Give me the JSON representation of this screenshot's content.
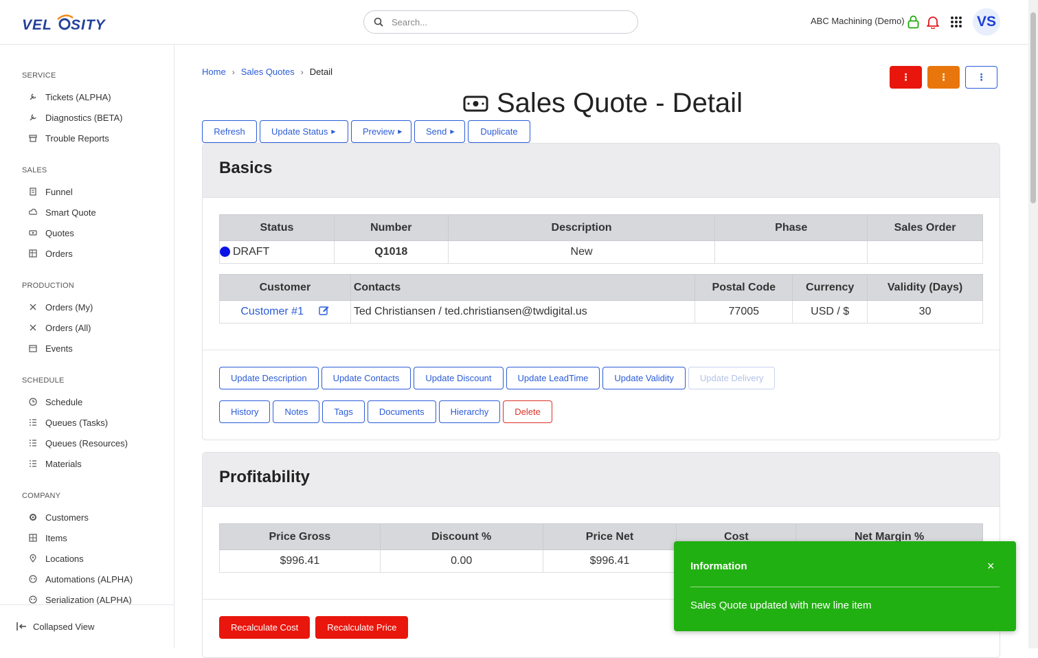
{
  "header": {
    "search_placeholder": "Search...",
    "company": "ABC Machining (Demo)",
    "avatar": "VS"
  },
  "sidebar": {
    "sections": [
      {
        "title": "SERVICE",
        "items": [
          "Tickets (ALPHA)",
          "Diagnostics (BETA)",
          "Trouble Reports"
        ]
      },
      {
        "title": "SALES",
        "items": [
          "Funnel",
          "Smart Quote",
          "Quotes",
          "Orders"
        ]
      },
      {
        "title": "PRODUCTION",
        "items": [
          "Orders (My)",
          "Orders (All)",
          "Events"
        ]
      },
      {
        "title": "SCHEDULE",
        "items": [
          "Schedule",
          "Queues (Tasks)",
          "Queues (Resources)",
          "Materials"
        ]
      },
      {
        "title": "COMPANY",
        "items": [
          "Customers",
          "Items",
          "Locations",
          "Automations (ALPHA)",
          "Serialization (ALPHA)"
        ]
      }
    ],
    "collapsed_label": "Collapsed View"
  },
  "breadcrumb": {
    "home": "Home",
    "section": "Sales Quotes",
    "current": "Detail"
  },
  "action_buttons": {
    "more": "⋮"
  },
  "page_title": "Sales Quote - Detail",
  "toolbar": {
    "refresh": "Refresh",
    "update_status": "Update Status",
    "preview": "Preview",
    "send": "Send",
    "duplicate": "Duplicate"
  },
  "basics": {
    "title": "Basics",
    "table1": {
      "headers": [
        "Status",
        "Number",
        "Description",
        "Phase",
        "Sales Order"
      ],
      "status": "DRAFT",
      "number": "Q1018",
      "description": "New",
      "phase": "",
      "sales_order": ""
    },
    "table2": {
      "headers": [
        "Customer",
        "Contacts",
        "Postal Code",
        "Currency",
        "Validity (Days)"
      ],
      "customer": "Customer #1",
      "contacts": "Ted Christiansen / ted.christiansen@twdigital.us",
      "postal_code": "77005",
      "currency": "USD / $",
      "validity": "30"
    },
    "buttons_row1": [
      "Update Description",
      "Update Contacts",
      "Update Discount",
      "Update LeadTime",
      "Update Validity",
      "Update Delivery"
    ],
    "buttons_row2": [
      "History",
      "Notes",
      "Tags",
      "Documents",
      "Hierarchy",
      "Delete"
    ]
  },
  "profitability": {
    "title": "Profitability",
    "headers": [
      "Price Gross",
      "Discount %",
      "Price Net",
      "Cost",
      "Net Margin %"
    ],
    "price_gross": "$996.41",
    "discount": "0.00",
    "price_net": "$996.41",
    "recalc_cost": "Recalculate Cost",
    "recalc_price": "Recalculate Price"
  },
  "toast": {
    "title": "Information",
    "close": "×",
    "message": "Sales Quote updated with new line item"
  }
}
